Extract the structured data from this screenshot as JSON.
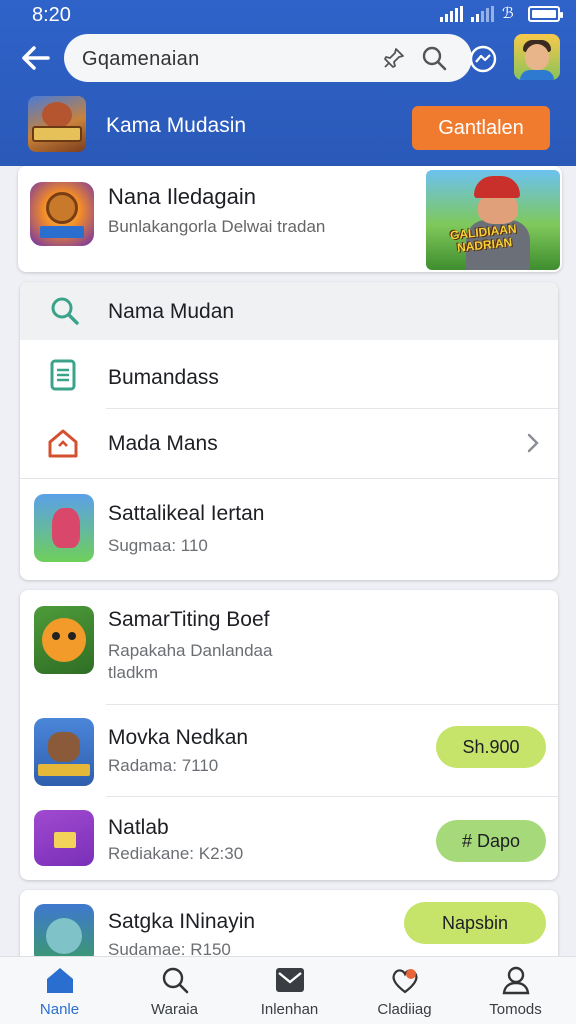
{
  "status_bar": {
    "time": "8:20"
  },
  "search": {
    "value": "Gqamenaian"
  },
  "game_header": {
    "title": "Kama Mudasin",
    "download_label": "Gantlalen"
  },
  "featured": {
    "title": "Nana Iledagain",
    "subtitle": "Bunlakangorla Delwai tradan",
    "banner_text": "GALIDIAAN NADRIAN"
  },
  "menu": {
    "search_row": "Nama Mudan",
    "items": [
      {
        "label": "Bumandass",
        "icon": "document-icon"
      },
      {
        "label": "Mada Mans",
        "icon": "home-icon"
      }
    ],
    "app": {
      "title": "Sattalikeal Iertan",
      "sub": "Sugmaa: 110"
    }
  },
  "apps": [
    {
      "title": "SamarTiting Boef",
      "sub": "Rapakaha Danlandaa tladkm"
    },
    {
      "title": "Movka Nedkan",
      "sub": "Radama: 7110",
      "action": "Sh.900"
    },
    {
      "title": "Natlab",
      "sub": "Rediakane: K2:30",
      "action": "# Dapo"
    }
  ],
  "bottom_app": {
    "title": "Satgka INinayin",
    "sub": "Sudamae: R150",
    "action": "Napsbin"
  },
  "tabs": [
    {
      "label": "Nanle",
      "icon": "home-icon",
      "active": true
    },
    {
      "label": "Waraia",
      "icon": "search-icon",
      "active": false
    },
    {
      "label": "Inlenhan",
      "icon": "mail-icon",
      "active": false
    },
    {
      "label": "Cladiiag",
      "icon": "heart-icon",
      "active": false
    },
    {
      "label": "Tomods",
      "icon": "user-icon",
      "active": false
    }
  ],
  "colors": {
    "header": "#2f63c9",
    "accent": "#f07a2e",
    "pill": "#c6e36a",
    "pill_alt": "#a6d97a",
    "active_tab": "#2a6fd0"
  }
}
